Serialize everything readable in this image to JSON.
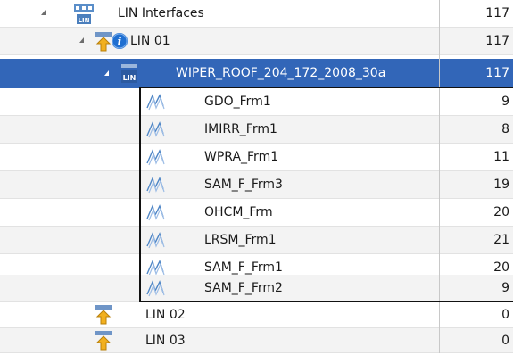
{
  "tree": {
    "root": {
      "label": "LIN Interfaces",
      "count": "117"
    },
    "lin01": {
      "label": "LIN 01",
      "count": "117"
    },
    "schedule": {
      "label": "WIPER_ROOF_204_172_2008_30a",
      "count": "117"
    },
    "frames": [
      {
        "label": "GDO_Frm1",
        "count": "9"
      },
      {
        "label": "IMIRR_Frm1",
        "count": "8"
      },
      {
        "label": "WPRA_Frm1",
        "count": "11"
      },
      {
        "label": "SAM_F_Frm3",
        "count": "19"
      },
      {
        "label": "OHCM_Frm",
        "count": "20"
      },
      {
        "label": "LRSM_Frm1",
        "count": "21"
      },
      {
        "label": "SAM_F_Frm1",
        "count": "20"
      },
      {
        "label": "SAM_F_Frm2",
        "count": "9"
      }
    ],
    "lin02": {
      "label": "LIN 02",
      "count": "0"
    },
    "lin03": {
      "label": "LIN 03",
      "count": "0"
    }
  },
  "icons": {
    "interfaces": "lin-interfaces-icon",
    "bus": "lin-bus-icon",
    "info": "info-icon",
    "schedule": "lin-schedule-icon",
    "frame": "signal-wave-icon"
  },
  "colors": {
    "selection": "#3266b8",
    "info_blue": "#1f6fd1",
    "arrow_yellow": "#f2b01e",
    "wave_blue": "#4f86c6"
  }
}
